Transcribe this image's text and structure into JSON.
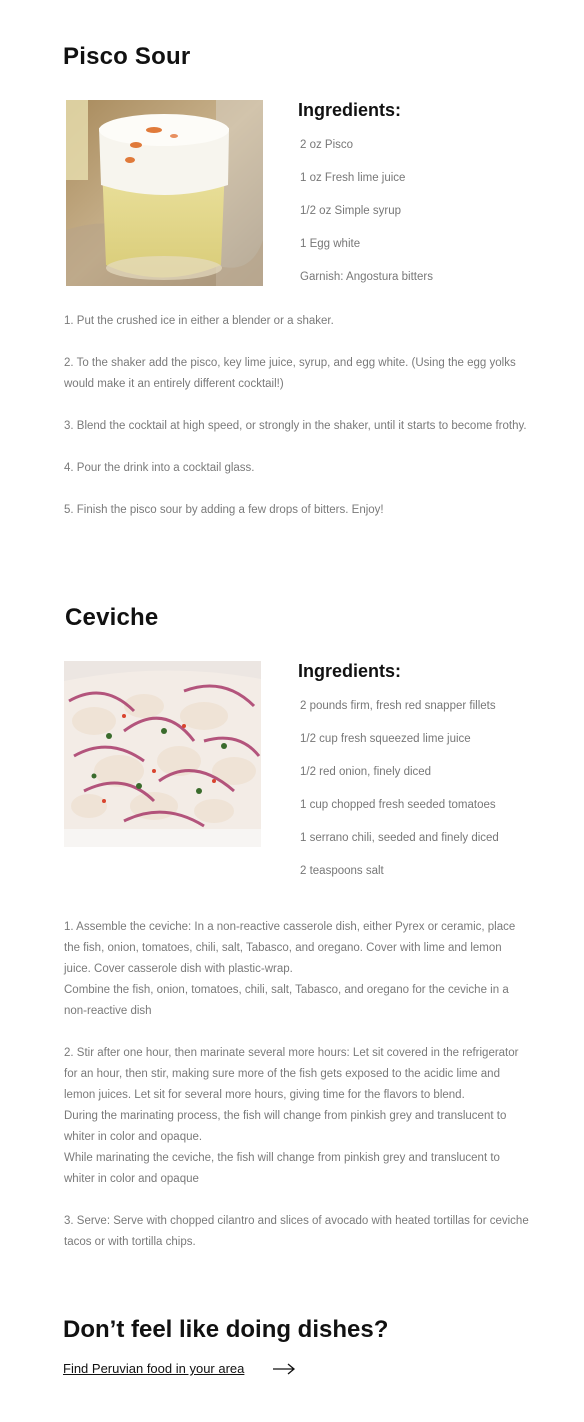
{
  "pisco": {
    "title": "Pisco Sour",
    "ingredients_heading": "Ingredients:",
    "ingredients": [
      "2 oz Pisco",
      "1 oz Fresh lime juice",
      "1/2 oz Simple syrup",
      "1 Egg white",
      "Garnish: Angostura bitters"
    ],
    "steps": [
      [
        "1. Put the crushed ice in either a blender or a shaker."
      ],
      [
        "2. To the shaker add the pisco, key lime juice, syrup, and egg white. (Using the egg yolks would make it an entirely different cocktail!)"
      ],
      [
        "3. Blend the cocktail at high speed, or strongly in the shaker, until it starts to become frothy."
      ],
      [
        "4. Pour the drink into a cocktail glass."
      ],
      [
        "5. Finish the pisco sour by adding a few drops of bitters. Enjoy!"
      ]
    ]
  },
  "ceviche": {
    "title": "Ceviche",
    "ingredients_heading": "Ingredients:",
    "ingredients": [
      "2 pounds firm, fresh red snapper fillets",
      "1/2 cup fresh squeezed lime juice",
      "1/2 red onion, finely diced",
      "1 cup chopped fresh seeded tomatoes",
      "1 serrano chili, seeded and finely diced",
      "2 teaspoons salt"
    ],
    "steps": [
      [
        "1. Assemble the ceviche: In a non-reactive casserole dish, either Pyrex or ceramic, place the fish, onion, tomatoes, chili, salt, Tabasco, and oregano. Cover with lime and lemon juice. Cover casserole dish with plastic-wrap.",
        "Combine the fish, onion, tomatoes, chili, salt, Tabasco, and oregano for the ceviche in a non-reactive dish"
      ],
      [
        "2. Stir after one hour, then marinate several more hours: Let sit covered in the refrigerator for an hour, then stir, making sure more of the fish gets exposed to the acidic lime and lemon juices. Let sit for several more hours, giving time for the flavors to blend.",
        "During the marinating process, the fish will change from pinkish grey and translucent to whiter in color and opaque.",
        "While marinating the ceviche, the fish will change from pinkish grey and translucent to whiter in color and opaque"
      ],
      [
        "3. Serve: Serve with chopped cilantro and slices of avocado with heated tortillas for ceviche tacos or with tortilla chips."
      ]
    ]
  },
  "cta": {
    "title": "Don’t feel like doing dishes?",
    "link_text": "Find Peruvian food in your area",
    "arrow_icon": "arrow-right-icon"
  }
}
